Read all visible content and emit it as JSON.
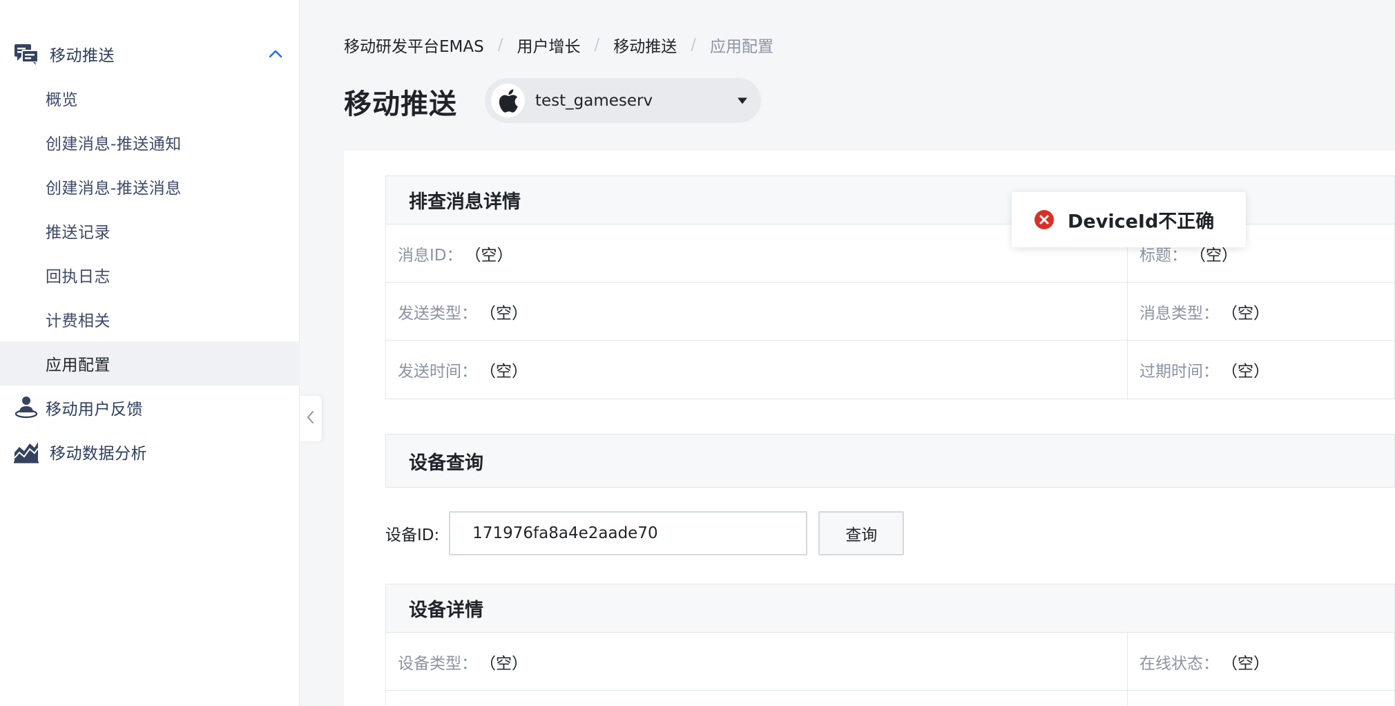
{
  "sidebar": {
    "push_group": {
      "label": "移动推送",
      "icon": "chat-bubbles-icon"
    },
    "push_items": [
      {
        "label": "概览"
      },
      {
        "label": "创建消息-推送通知"
      },
      {
        "label": "创建消息-推送消息"
      },
      {
        "label": "推送记录"
      },
      {
        "label": "回执日志"
      },
      {
        "label": "计费相关"
      },
      {
        "label": "应用配置",
        "active": true
      }
    ],
    "feedback_group": {
      "label": "移动用户反馈",
      "icon": "user-feedback-icon"
    },
    "analytics_group": {
      "label": "移动数据分析",
      "icon": "analytics-chart-icon"
    }
  },
  "breadcrumb": {
    "items": [
      "移动研发平台EMAS",
      "用户增长",
      "移动推送",
      "应用配置"
    ],
    "separator": "/"
  },
  "page": {
    "title": "移动推送",
    "app_selector": {
      "value": "test_gameserv",
      "icon": "apple-icon"
    }
  },
  "message_detail": {
    "title": "排查消息详情",
    "rows": [
      {
        "left_label": "消息ID：",
        "left_value": "（空）",
        "right_label": "标题：",
        "right_value": "（空）"
      },
      {
        "left_label": "发送类型：",
        "left_value": "（空）",
        "right_label": "消息类型：",
        "right_value": "（空）"
      },
      {
        "left_label": "发送时间：",
        "left_value": "（空）",
        "right_label": "过期时间：",
        "right_value": "（空）"
      }
    ]
  },
  "device_query": {
    "title": "设备查询",
    "label": "设备ID:",
    "input_value": "171976fa8a4e2aade70",
    "button_label": "查询"
  },
  "device_detail": {
    "title": "设备详情",
    "rows": [
      {
        "left_label": "设备类型：",
        "left_value": "（空）",
        "right_label": "在线状态：",
        "right_value": "（空）"
      }
    ]
  },
  "toast": {
    "type": "error",
    "message": "DeviceId不正确",
    "color": "#d93026"
  },
  "colors": {
    "sidebar_text": "#2c3e5c",
    "active_bg": "#f0f1f4",
    "muted": "#8b93a3"
  }
}
